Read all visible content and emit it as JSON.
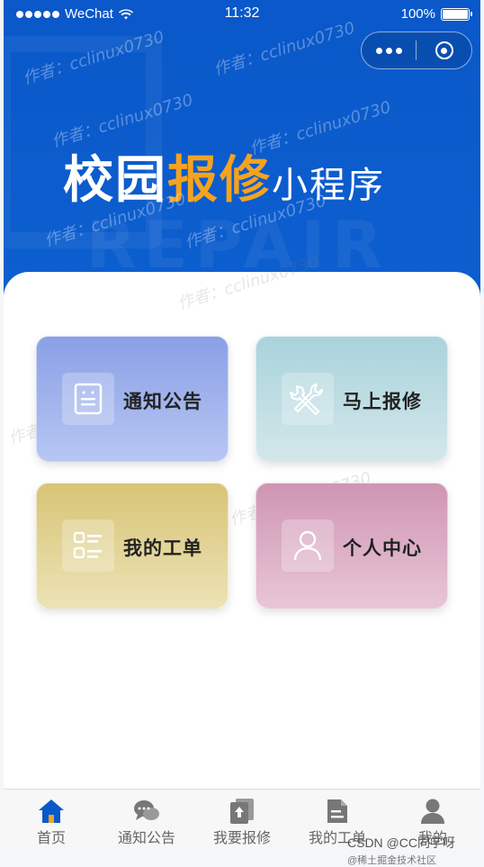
{
  "status_bar": {
    "carrier": "WeChat",
    "time": "11:32",
    "battery": "100%"
  },
  "capsule": {
    "more_icon": "more-dots-icon",
    "close_icon": "record-circle-icon"
  },
  "hero": {
    "title_part1": "校园",
    "title_part2": "报修",
    "title_part3": "小程序",
    "accent_color": "#f3a320",
    "background_color": "#0a58c9",
    "decor_text": "REPAIR"
  },
  "watermark_text": "作者：cclinux0730",
  "cards": [
    {
      "label": "通知公告",
      "icon": "notice-board-icon"
    },
    {
      "label": "马上报修",
      "icon": "tools-icon"
    },
    {
      "label": "我的工单",
      "icon": "list-icon"
    },
    {
      "label": "个人中心",
      "icon": "user-icon"
    }
  ],
  "tabbar": [
    {
      "label": "首页",
      "icon": "home-icon",
      "active": true
    },
    {
      "label": "通知公告",
      "icon": "chat-bubbles-icon"
    },
    {
      "label": "我要报修",
      "icon": "upload-doc-icon"
    },
    {
      "label": "我的工单",
      "icon": "document-icon"
    },
    {
      "label": "我的",
      "icon": "person-icon"
    }
  ],
  "footer_credit": "CSDN @CC同学呀",
  "footer_credit_small": "@稀土掘金技术社区"
}
